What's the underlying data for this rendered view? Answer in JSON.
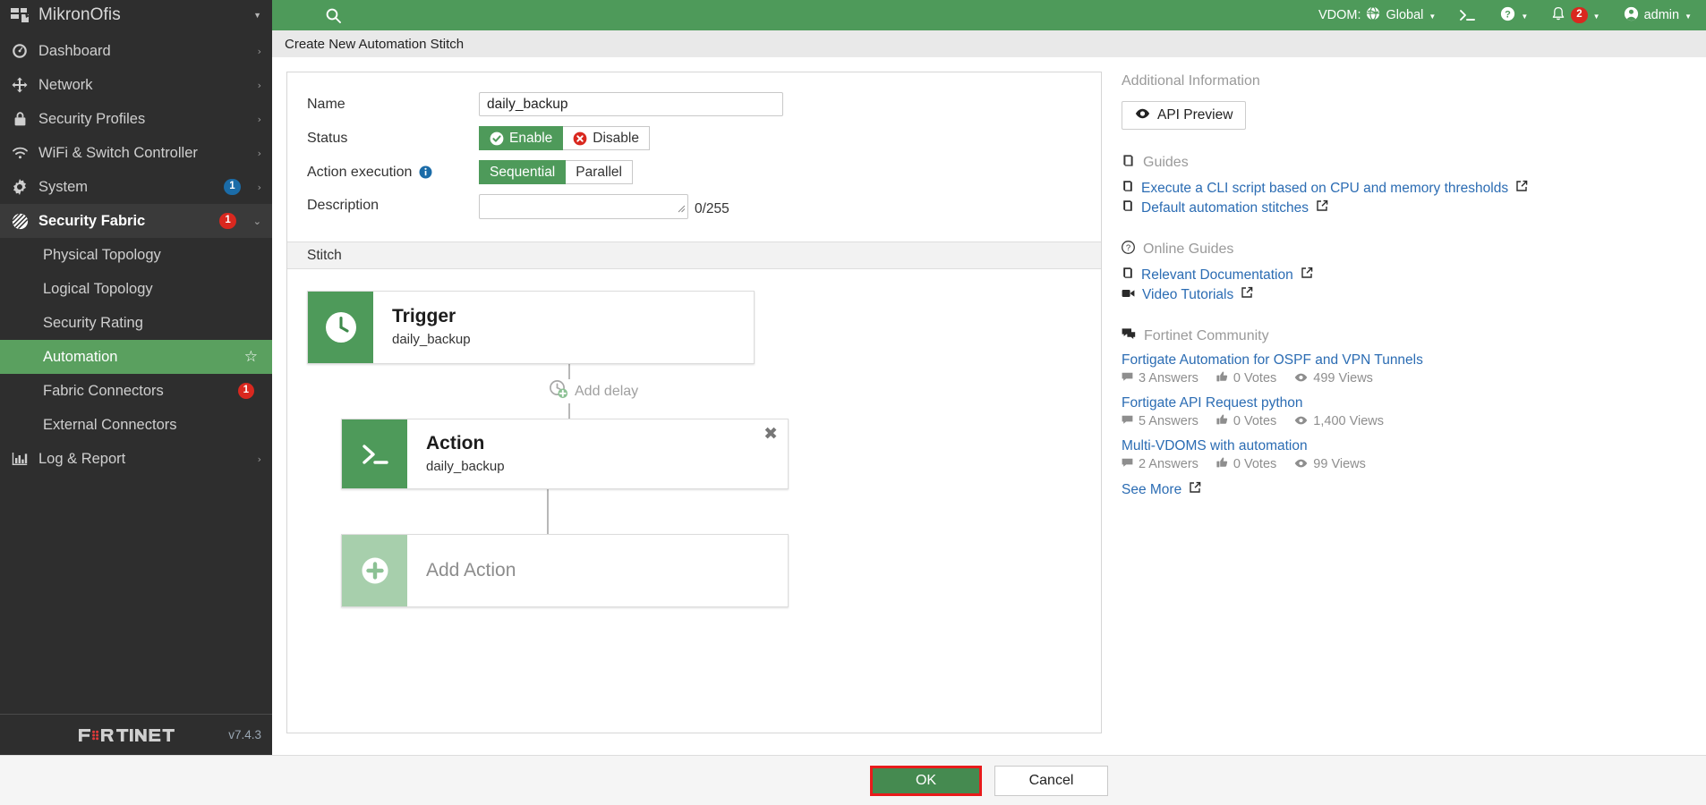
{
  "brand": {
    "name": "MikronOfis"
  },
  "topbar": {
    "menu_icon": "hamburger-icon",
    "search_icon": "search-icon",
    "vdom_label": "VDOM:",
    "vdom_value": "Global",
    "cli_icon": "cli-console-icon",
    "help_icon": "help-icon",
    "notification_icon": "bell-icon",
    "notification_count": "2",
    "user": "admin"
  },
  "sidebar": {
    "items": [
      {
        "label": "Dashboard",
        "icon": "dashboard-icon",
        "arrow": "›",
        "badge": "",
        "badge_color": ""
      },
      {
        "label": "Network",
        "icon": "network-icon",
        "arrow": "›",
        "badge": "",
        "badge_color": ""
      },
      {
        "label": "Security Profiles",
        "icon": "lock-icon",
        "arrow": "›",
        "badge": "",
        "badge_color": ""
      },
      {
        "label": "WiFi & Switch Controller",
        "icon": "wifi-icon",
        "arrow": "›",
        "badge": "",
        "badge_color": ""
      },
      {
        "label": "System",
        "icon": "gear-icon",
        "arrow": "›",
        "badge": "1",
        "badge_color": "#1b6ca8"
      },
      {
        "label": "Security Fabric",
        "icon": "security-fabric-icon",
        "arrow": "⌄",
        "badge": "1",
        "badge_color": "#d9281f"
      }
    ],
    "sub_items": [
      {
        "label": "Physical Topology",
        "active": false,
        "badge": ""
      },
      {
        "label": "Logical Topology",
        "active": false,
        "badge": ""
      },
      {
        "label": "Security Rating",
        "active": false,
        "badge": ""
      },
      {
        "label": "Automation",
        "active": true,
        "badge": ""
      },
      {
        "label": "Fabric Connectors",
        "active": false,
        "badge": "1"
      },
      {
        "label": "External Connectors",
        "active": false,
        "badge": ""
      }
    ],
    "log_report": {
      "label": "Log & Report",
      "icon": "chart-icon",
      "arrow": "›"
    },
    "footer": {
      "logo": "fortinet-logo",
      "version": "v7.4.3"
    }
  },
  "page": {
    "title": "Create New Automation Stitch"
  },
  "form": {
    "name_label": "Name",
    "name_value": "daily_backup",
    "name_placeholder": "",
    "status_label": "Status",
    "status_enable": "Enable",
    "status_disable": "Disable",
    "status_selected": "Enable",
    "action_execution_label": "Action execution",
    "action_info_icon": "info-icon",
    "action_sequential": "Sequential",
    "action_parallel": "Parallel",
    "action_selected": "Sequential",
    "description_label": "Description",
    "description_value": "",
    "description_counter": "0/255"
  },
  "stitch": {
    "section_label": "Stitch",
    "trigger": {
      "title": "Trigger",
      "subtitle": "daily_backup",
      "icon": "clock-icon"
    },
    "add_delay": {
      "label": "Add delay",
      "icon": "clock-plus-icon"
    },
    "action": {
      "title": "Action",
      "subtitle": "daily_backup",
      "icon": "cli-script-icon",
      "close_icon": "close-icon"
    },
    "add_action": {
      "label": "Add Action",
      "icon": "plus-circle-icon"
    }
  },
  "additional_info": {
    "heading": "Additional Information",
    "api_preview": "API Preview",
    "api_preview_icon": "eye-icon",
    "guides_heading": "Guides",
    "guides_icon": "book-icon",
    "guides": [
      {
        "label": "Execute a CLI script based on CPU and memory thresholds",
        "icon": "book-icon",
        "external": true
      },
      {
        "label": "Default automation stitches",
        "icon": "book-icon",
        "external": true
      }
    ],
    "online_guides_heading": "Online Guides",
    "online_guides_icon": "question-circle-icon",
    "online_guides": [
      {
        "label": "Relevant Documentation",
        "icon": "book-icon",
        "external": true
      },
      {
        "label": "Video Tutorials",
        "icon": "video-icon",
        "external": true
      }
    ],
    "community_heading": "Fortinet Community",
    "community_icon": "comments-icon",
    "community_posts": [
      {
        "title": "Fortigate Automation for OSPF and VPN Tunnels",
        "answers": "3 Answers",
        "votes": "0 Votes",
        "views": "499 Views"
      },
      {
        "title": "Fortigate API Request python",
        "answers": "5 Answers",
        "votes": "0 Votes",
        "views": "1,400 Views"
      },
      {
        "title": "Multi-VDOMS with automation",
        "answers": "2 Answers",
        "votes": "0 Votes",
        "views": "99 Views"
      }
    ],
    "see_more": "See More"
  },
  "footer": {
    "ok": "OK",
    "cancel": "Cancel",
    "ok_highlight_color": "#e81b1b"
  }
}
